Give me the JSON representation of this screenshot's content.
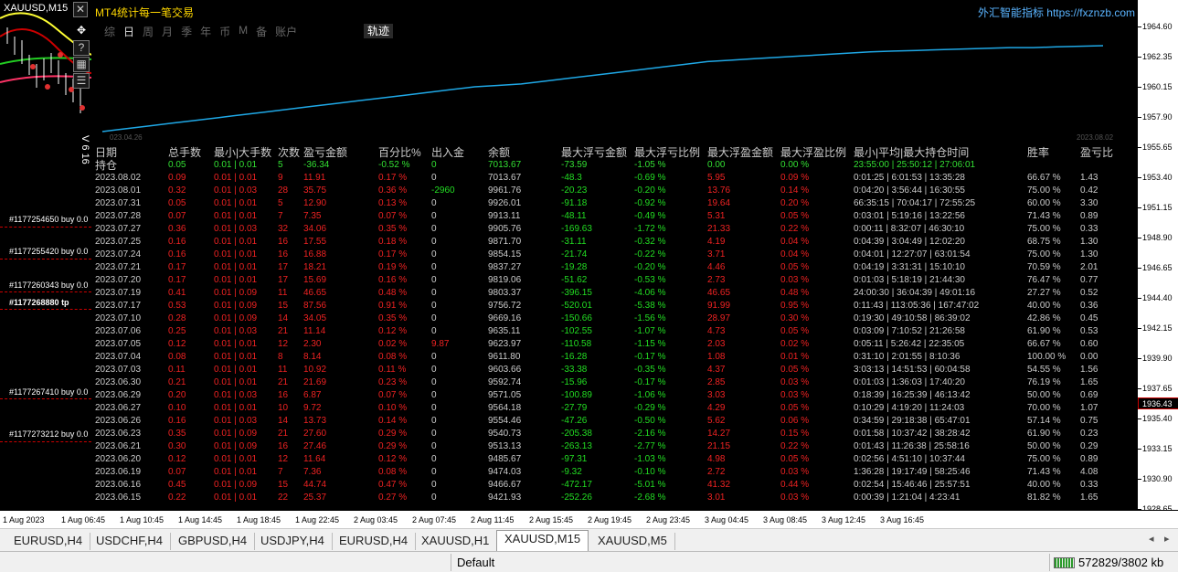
{
  "left_chart": {
    "symbol": "XAUUSD,M15",
    "side_label": "V 6 16",
    "orders": [
      {
        "text": "#1177254650 buy 0.0"
      },
      {
        "text": "#1177255420 buy 0.0"
      },
      {
        "text": "#1177260343 buy 0.0"
      },
      {
        "text": "#1177268880 tp"
      },
      {
        "text": "#1177267410 buy 0.0"
      },
      {
        "text": "#1177273212 buy 0.0"
      }
    ]
  },
  "panel": {
    "title": "MT4统计每一笔交易",
    "brand": "外汇智能指标 https://fxznzb.com",
    "tabs": [
      "综",
      "日",
      "周",
      "月",
      "季",
      "年",
      "币",
      "M",
      "备",
      "账户"
    ],
    "active_tab": "日",
    "track_button": "轨迹",
    "date_start": "023.04.26",
    "date_end": "2023.08.02",
    "line_color": "#1fa8e6"
  },
  "equity_curve": [
    7013.67,
    7010.0,
    7005.0,
    7000.0,
    7000.0,
    6995.0,
    6990.0,
    6985.0,
    6980.0,
    6975.0,
    6970.0,
    6960.0,
    6950.0,
    6940.0,
    6930.0,
    6920.0,
    6910.0,
    6900.0,
    6880.0,
    6860.0,
    6840.0,
    6820.0,
    6800.0,
    6780.0,
    6760.0,
    6740.0,
    6730.0,
    6720.0,
    6700.0,
    6680.0,
    6660.0,
    6640.0,
    6620.0,
    6600.0,
    6580.0,
    6560.0,
    6540.0,
    6520.0,
    6500.0,
    6480.0,
    6460.0,
    6440.0,
    6420.0,
    6400.0
  ],
  "stats": {
    "headers": [
      "日期",
      "总手数",
      "最小|大手数",
      "次数",
      "盈亏金额",
      "百分比%",
      "出入金",
      "余额",
      "最大浮亏金额",
      "最大浮亏比例",
      "最大浮盈金额",
      "最大浮盈比例",
      "最小|平均|最大持仓时间",
      "胜率",
      "盈亏比"
    ],
    "summary": [
      "持仓",
      "0.05",
      "0.01 | 0.01",
      "5",
      "-36.34",
      "-0.52 %",
      "0",
      "7013.67",
      "-73.59",
      "-1.05 %",
      "0.00",
      "0.00 %",
      "23:55:00 | 25:50:12 | 27:06:01",
      "",
      ""
    ],
    "rows": [
      [
        "2023.08.02",
        "0.09",
        "0.01 | 0.01",
        "9",
        "11.91",
        "0.17 %",
        "0",
        "7013.67",
        "-48.3",
        "-0.69 %",
        "5.95",
        "0.09 %",
        "0:01:25 | 6:01:53 | 13:35:28",
        "66.67 %",
        "1.43"
      ],
      [
        "2023.08.01",
        "0.32",
        "0.01 | 0.03",
        "28",
        "35.75",
        "0.36 %",
        "-2960",
        "9961.76",
        "-20.23",
        "-0.20 %",
        "13.76",
        "0.14 %",
        "0:04:20 | 3:56:44 | 16:30:55",
        "75.00 %",
        "0.42"
      ],
      [
        "2023.07.31",
        "0.05",
        "0.01 | 0.01",
        "5",
        "12.90",
        "0.13 %",
        "0",
        "9926.01",
        "-91.18",
        "-0.92 %",
        "19.64",
        "0.20 %",
        "66:35:15 | 70:04:17 | 72:55:25",
        "60.00 %",
        "3.30"
      ],
      [
        "2023.07.28",
        "0.07",
        "0.01 | 0.01",
        "7",
        "7.35",
        "0.07 %",
        "0",
        "9913.11",
        "-48.11",
        "-0.49 %",
        "5.31",
        "0.05 %",
        "0:03:01 | 5:19:16 | 13:22:56",
        "71.43 %",
        "0.89"
      ],
      [
        "2023.07.27",
        "0.36",
        "0.01 | 0.03",
        "32",
        "34.06",
        "0.35 %",
        "0",
        "9905.76",
        "-169.63",
        "-1.72 %",
        "21.33",
        "0.22 %",
        "0:00:11 | 8:32:07 | 46:30:10",
        "75.00 %",
        "0.33"
      ],
      [
        "2023.07.25",
        "0.16",
        "0.01 | 0.01",
        "16",
        "17.55",
        "0.18 %",
        "0",
        "9871.70",
        "-31.11",
        "-0.32 %",
        "4.19",
        "0.04 %",
        "0:04:39 | 3:04:49 | 12:02:20",
        "68.75 %",
        "1.30"
      ],
      [
        "2023.07.24",
        "0.16",
        "0.01 | 0.01",
        "16",
        "16.88",
        "0.17 %",
        "0",
        "9854.15",
        "-21.74",
        "-0.22 %",
        "3.71",
        "0.04 %",
        "0:04:01 | 12:27:07 | 63:01:54",
        "75.00 %",
        "1.30"
      ],
      [
        "2023.07.21",
        "0.17",
        "0.01 | 0.01",
        "17",
        "18.21",
        "0.19 %",
        "0",
        "9837.27",
        "-19.28",
        "-0.20 %",
        "4.46",
        "0.05 %",
        "0:04:19 | 3:31:31 | 15:10:10",
        "70.59 %",
        "2.01"
      ],
      [
        "2023.07.20",
        "0.17",
        "0.01 | 0.01",
        "17",
        "15.69",
        "0.16 %",
        "0",
        "9819.06",
        "-51.62",
        "-0.53 %",
        "2.73",
        "0.03 %",
        "0:01:03 | 5:18:19 | 21:44:30",
        "76.47 %",
        "0.77"
      ],
      [
        "2023.07.19",
        "0.41",
        "0.01 | 0.09",
        "11",
        "46.65",
        "0.48 %",
        "0",
        "9803.37",
        "-396.15",
        "-4.06 %",
        "46.65",
        "0.48 %",
        "24:00:30 | 36:04:39 | 49:01:16",
        "27.27 %",
        "0.52"
      ],
      [
        "2023.07.17",
        "0.53",
        "0.01 | 0.09",
        "15",
        "87.56",
        "0.91 %",
        "0",
        "9756.72",
        "-520.01",
        "-5.38 %",
        "91.99",
        "0.95 %",
        "0:11:43 | 113:05:36 | 167:47:02",
        "40.00 %",
        "0.36"
      ],
      [
        "2023.07.10",
        "0.28",
        "0.01 | 0.09",
        "14",
        "34.05",
        "0.35 %",
        "0",
        "9669.16",
        "-150.66",
        "-1.56 %",
        "28.97",
        "0.30 %",
        "0:19:30 | 49:10:58 | 86:39:02",
        "42.86 %",
        "0.45"
      ],
      [
        "2023.07.06",
        "0.25",
        "0.01 | 0.03",
        "21",
        "11.14",
        "0.12 %",
        "0",
        "9635.11",
        "-102.55",
        "-1.07 %",
        "4.73",
        "0.05 %",
        "0:03:09 | 7:10:52 | 21:26:58",
        "61.90 %",
        "0.53"
      ],
      [
        "2023.07.05",
        "0.12",
        "0.01 | 0.01",
        "12",
        "2.30",
        "0.02 %",
        "9.87",
        "9623.97",
        "-110.58",
        "-1.15 %",
        "2.03",
        "0.02 %",
        "0:05:11 | 5:26:42 | 22:35:05",
        "66.67 %",
        "0.60"
      ],
      [
        "2023.07.04",
        "0.08",
        "0.01 | 0.01",
        "8",
        "8.14",
        "0.08 %",
        "0",
        "9611.80",
        "-16.28",
        "-0.17 %",
        "1.08",
        "0.01 %",
        "0:31:10 | 2:01:55 | 8:10:36",
        "100.00 %",
        "0.00"
      ],
      [
        "2023.07.03",
        "0.11",
        "0.01 | 0.01",
        "11",
        "10.92",
        "0.11 %",
        "0",
        "9603.66",
        "-33.38",
        "-0.35 %",
        "4.37",
        "0.05 %",
        "3:03:13 | 14:51:53 | 60:04:58",
        "54.55 %",
        "1.56"
      ],
      [
        "2023.06.30",
        "0.21",
        "0.01 | 0.01",
        "21",
        "21.69",
        "0.23 %",
        "0",
        "9592.74",
        "-15.96",
        "-0.17 %",
        "2.85",
        "0.03 %",
        "0:01:03 | 1:36:03 | 17:40:20",
        "76.19 %",
        "1.65"
      ],
      [
        "2023.06.29",
        "0.20",
        "0.01 | 0.03",
        "16",
        "6.87",
        "0.07 %",
        "0",
        "9571.05",
        "-100.89",
        "-1.06 %",
        "3.03",
        "0.03 %",
        "0:18:39 | 16:25:39 | 46:13:42",
        "50.00 %",
        "0.69"
      ],
      [
        "2023.06.27",
        "0.10",
        "0.01 | 0.01",
        "10",
        "9.72",
        "0.10 %",
        "0",
        "9564.18",
        "-27.79",
        "-0.29 %",
        "4.29",
        "0.05 %",
        "0:10:29 | 4:19:20 | 11:24:03",
        "70.00 %",
        "1.07"
      ],
      [
        "2023.06.26",
        "0.16",
        "0.01 | 0.03",
        "14",
        "13.73",
        "0.14 %",
        "0",
        "9554.46",
        "-47.26",
        "-0.50 %",
        "5.62",
        "0.06 %",
        "0:34:59 | 29:18:38 | 65:47:01",
        "57.14 %",
        "0.75"
      ],
      [
        "2023.06.23",
        "0.35",
        "0.01 | 0.09",
        "21",
        "27.60",
        "0.29 %",
        "0",
        "9540.73",
        "-205.38",
        "-2.16 %",
        "14.27",
        "0.15 %",
        "0:01:58 | 10:37:42 | 38:28:42",
        "61.90 %",
        "0.23"
      ],
      [
        "2023.06.21",
        "0.30",
        "0.01 | 0.09",
        "16",
        "27.46",
        "0.29 %",
        "0",
        "9513.13",
        "-263.13",
        "-2.77 %",
        "21.15",
        "0.22 %",
        "0:01:43 | 11:26:38 | 25:58:16",
        "50.00 %",
        "0.29"
      ],
      [
        "2023.06.20",
        "0.12",
        "0.01 | 0.01",
        "12",
        "11.64",
        "0.12 %",
        "0",
        "9485.67",
        "-97.31",
        "-1.03 %",
        "4.98",
        "0.05 %",
        "0:02:56 | 4:51:10 | 10:37:44",
        "75.00 %",
        "0.89"
      ],
      [
        "2023.06.19",
        "0.07",
        "0.01 | 0.01",
        "7",
        "7.36",
        "0.08 %",
        "0",
        "9474.03",
        "-9.32",
        "-0.10 %",
        "2.72",
        "0.03 %",
        "1:36:28 | 19:17:49 | 58:25:46",
        "71.43 %",
        "4.08"
      ],
      [
        "2023.06.16",
        "0.45",
        "0.01 | 0.09",
        "15",
        "44.74",
        "0.47 %",
        "0",
        "9466.67",
        "-472.17",
        "-5.01 %",
        "41.32",
        "0.44 %",
        "0:02:54 | 15:46:46 | 25:57:51",
        "40.00 %",
        "0.33"
      ],
      [
        "2023.06.15",
        "0.22",
        "0.01 | 0.01",
        "22",
        "25.37",
        "0.27 %",
        "0",
        "9421.93",
        "-252.26",
        "-2.68 %",
        "3.01",
        "0.03 %",
        "0:00:39 | 1:21:04 | 4:23:41",
        "81.82 %",
        "1.65"
      ]
    ]
  },
  "price_axis": {
    "ticks": [
      "1964.60",
      "1962.35",
      "1960.15",
      "1957.90",
      "1955.65",
      "1953.40",
      "1951.15",
      "1948.90",
      "1946.65",
      "1944.40",
      "1942.15",
      "1939.90",
      "1937.65",
      "1935.40",
      "1933.15",
      "1930.90",
      "1928.65"
    ],
    "current": "1936.43"
  },
  "time_axis": [
    "1 Aug 2023",
    "1 Aug 06:45",
    "1 Aug 10:45",
    "1 Aug 14:45",
    "1 Aug 18:45",
    "1 Aug 22:45",
    "2 Aug 03:45",
    "2 Aug 07:45",
    "2 Aug 11:45",
    "2 Aug 15:45",
    "2 Aug 19:45",
    "2 Aug 23:45",
    "3 Aug 04:45",
    "3 Aug 08:45",
    "3 Aug 12:45",
    "3 Aug 16:45"
  ],
  "chart_tabs": [
    "EURUSD,H4",
    "USDCHF,H4",
    "GBPUSD,H4",
    "USDJPY,H4",
    "EURUSD,H4",
    "XAUUSD,H1",
    "XAUUSD,M15",
    "XAUUSD,M5"
  ],
  "active_chart_tab": "XAUUSD,M15",
  "status": {
    "profile": "Default",
    "traffic": "572829/3802 kb"
  }
}
